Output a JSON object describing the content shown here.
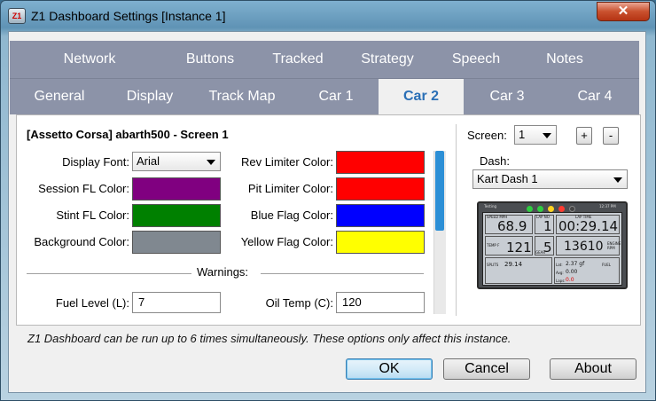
{
  "window": {
    "title": "Z1 Dashboard Settings [Instance 1]",
    "icon_text": "Z1",
    "close_label": "✕"
  },
  "tabs_row1": [
    "Network",
    "Buttons",
    "Tracked",
    "Strategy",
    "Speech",
    "Notes"
  ],
  "tabs_row2": [
    "General",
    "Display",
    "Track Map",
    "Car 1",
    "Car 2",
    "Car 3",
    "Car 4"
  ],
  "active_tab": "Car 2",
  "settings": {
    "heading": "[Assetto Corsa] abarth500 - Screen 1",
    "display_font_label": "Display Font:",
    "display_font_value": "Arial",
    "session_fl_label": "Session FL Color:",
    "stint_fl_label": "Stint FL Color:",
    "background_label": "Background Color:",
    "rev_limiter_label": "Rev Limiter Color:",
    "pit_limiter_label": "Pit Limiter Color:",
    "blue_flag_label": "Blue Flag Color:",
    "yellow_flag_label": "Yellow Flag Color:",
    "warnings_label": "Warnings:",
    "fuel_level_label": "Fuel Level (L):",
    "fuel_level_value": "7",
    "oil_temp_label": "Oil Temp (C):",
    "oil_temp_value": "120"
  },
  "colors": {
    "session_fl": "#800080",
    "stint_fl": "#008000",
    "background": "#808890",
    "rev_limiter": "#ff0000",
    "pit_limiter": "#ff0000",
    "blue_flag": "#0000ff",
    "yellow_flag": "#ffff00",
    "tab_active_text": "#2a6fb6"
  },
  "right_panel": {
    "screen_label": "Screen:",
    "screen_value": "1",
    "add_label": "+",
    "remove_label": "-",
    "dash_label": "Dash:",
    "dash_value": "Kart Dash 1"
  },
  "dash_preview": {
    "header_left": "Testing",
    "header_right": "12:37 PM",
    "speed_label": "SPEED MPH",
    "speed": "68.9",
    "lap_no_label": "LAP NO",
    "lap_no": "1",
    "lap_time_label": "LAP TIME",
    "lap_time": "00:29.14",
    "temp_label": "TEMP F",
    "temp": "121",
    "gear_label": "GEAR",
    "gear": "5",
    "rpm": "13610",
    "engine_rpm_label": "ENGINE RPM",
    "split_label": "SPLITS",
    "split": "29.14",
    "lat_label": "Lat:",
    "lat": "2.37 gf",
    "fuel_label": "FUEL",
    "avg_label": "Avg:",
    "avg": "0.00",
    "laps_label": "Laps:",
    "laps": "0.0"
  },
  "status_text": "Z1 Dashboard can be run up to 6 times simultaneously. These options only affect this instance.",
  "buttons": {
    "ok": "OK",
    "cancel": "Cancel",
    "about": "About"
  }
}
